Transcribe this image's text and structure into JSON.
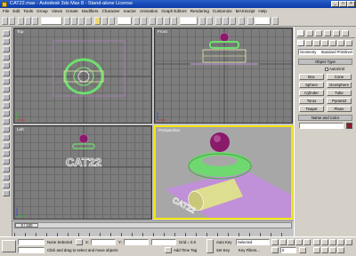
{
  "window": {
    "title": "CAT22.max - Autodesk 3ds Max 8 - Stand-alone License",
    "minimize": "_",
    "maximize": "□",
    "close": "×"
  },
  "menu": [
    "File",
    "Edit",
    "Tools",
    "Group",
    "Views",
    "Create",
    "Modifiers",
    "Character",
    "reactor",
    "Animation",
    "Graph Editors",
    "Rendering",
    "Customize",
    "MAXScript",
    "Help"
  ],
  "viewports": {
    "top": "Top",
    "front": "Front",
    "left": "Left",
    "perspective": "Perspective"
  },
  "scene_text": "CAT22",
  "command_panel": {
    "dropdown": "Geometry",
    "dropdown2": "Standard Primitives",
    "object_type_header": "Object Type",
    "autogrid": "AutoGrid",
    "buttons": [
      "Box",
      "Cone",
      "Sphere",
      "GeoSphere",
      "Cylinder",
      "Tube",
      "Torus",
      "Pyramid",
      "Teapot",
      "Plane"
    ],
    "name_color_header": "Name and Color"
  },
  "timeslider": {
    "label": "0 / 100"
  },
  "status": {
    "none_selected": "None Selected",
    "prompt": "Click and drag to select and move objects",
    "x_label": "X:",
    "y_label": "Y:",
    "grid_label": "Grid = 0.0",
    "add_time_tag": "Add Time Tag",
    "auto_key": "Auto Key",
    "set_key": "Set Key",
    "selected": "Selected",
    "key_filters": "Key Filters...",
    "frame": "0"
  },
  "colors": {
    "accent_viewport": "#f4e60a",
    "selection_green": "#6ee06e",
    "sphere_magenta": "#8a1a6a",
    "cylinder": "#dede90",
    "floor": "#c090d8",
    "object_color": "#8b1c2e"
  }
}
